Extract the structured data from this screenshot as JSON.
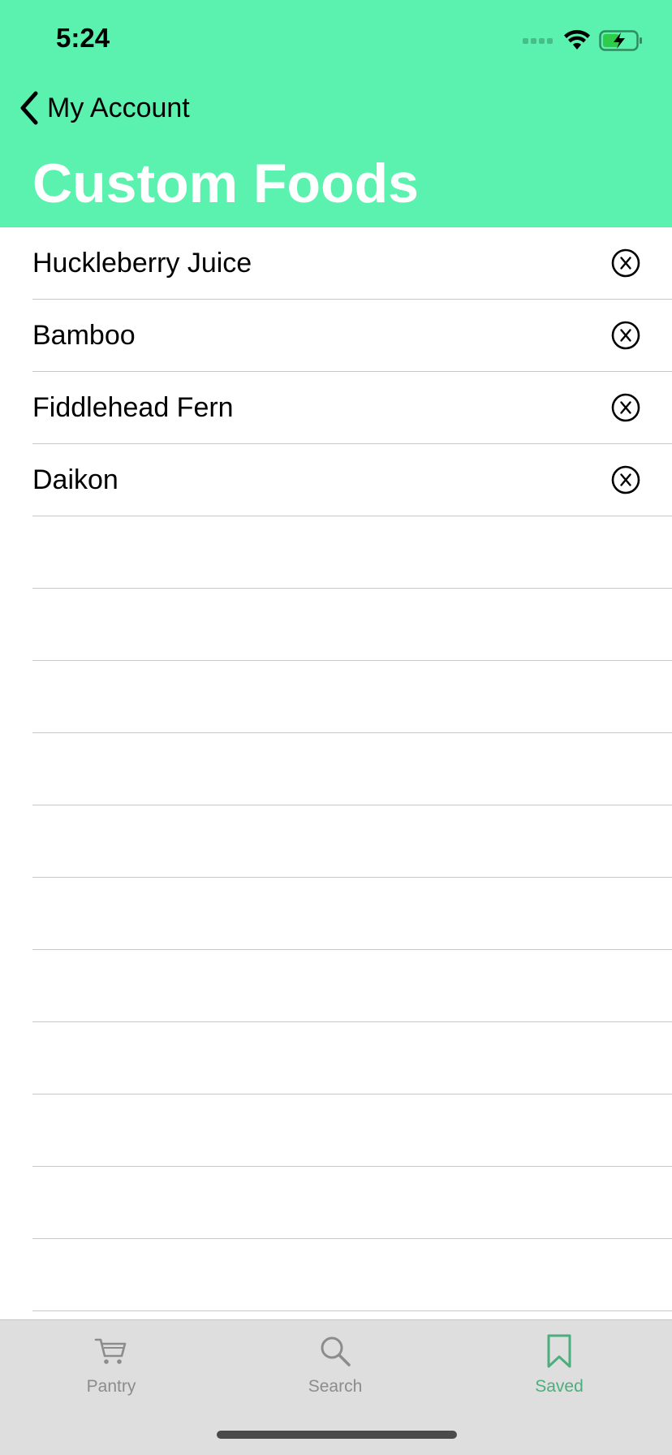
{
  "status_bar": {
    "time": "5:24"
  },
  "nav": {
    "back_label": "My Account",
    "title": "Custom Foods"
  },
  "foods": [
    {
      "name": "Huckleberry Juice"
    },
    {
      "name": "Bamboo"
    },
    {
      "name": "Fiddlehead Fern"
    },
    {
      "name": "Daikon"
    }
  ],
  "empty_rows": 11,
  "tabs": [
    {
      "label": "Pantry",
      "icon": "cart-icon",
      "active": false
    },
    {
      "label": "Search",
      "icon": "magnifier-icon",
      "active": false
    },
    {
      "label": "Saved",
      "icon": "bookmark-icon",
      "active": true
    }
  ],
  "colors": {
    "header_bg": "#5af2ae",
    "tab_active": "#4cae7c",
    "tab_inactive": "#8c8c8c",
    "tabbar_bg": "#dedede"
  }
}
